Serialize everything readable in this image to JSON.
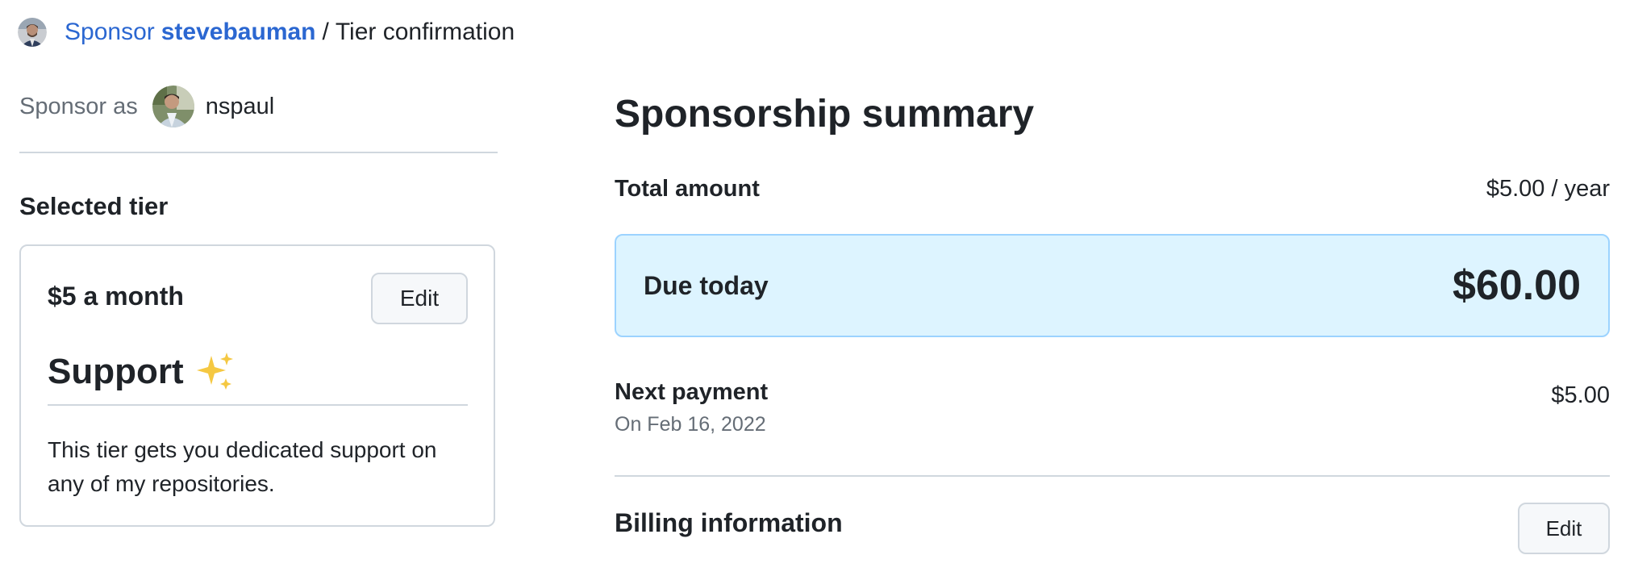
{
  "header": {
    "sponsor_link": "Sponsor",
    "maintainer": "stevebauman",
    "separator": "/",
    "current_page": "Tier confirmation"
  },
  "sponsor_as": {
    "label": "Sponsor as",
    "username": "nspaul"
  },
  "selected_tier": {
    "title": "Selected tier",
    "price": "$5 a month",
    "edit_label": "Edit",
    "name": "Support",
    "description": "This tier gets you dedicated support on any of my repositories."
  },
  "summary": {
    "title": "Sponsorship summary",
    "total_label": "Total amount",
    "total_value": "$5.00 / year",
    "due_label": "Due today",
    "due_amount": "$60.00",
    "next_label": "Next payment",
    "next_date": "On Feb 16, 2022",
    "next_value": "$5.00",
    "billing_label": "Billing information",
    "billing_edit_label": "Edit"
  },
  "colors": {
    "link": "#2b67d1",
    "due_box_bg": "#ddf4ff",
    "due_box_border": "#9cd3ff",
    "muted_text": "#656d76",
    "border": "#d0d7de"
  },
  "icons": {
    "maintainer_avatar": "avatar-stevebauman",
    "sponsor_avatar": "avatar-nspaul",
    "tier_emoji": "sparkles-icon"
  }
}
